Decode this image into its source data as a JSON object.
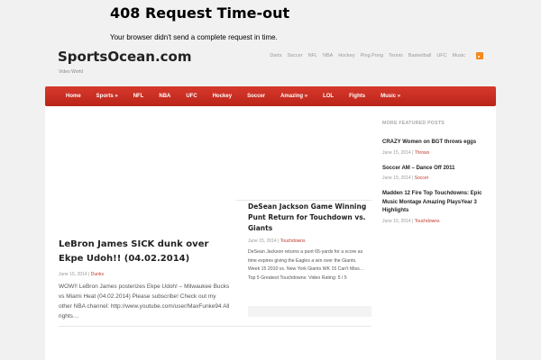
{
  "error": {
    "title": "408 Request Time-out",
    "message": "Your browser didn't send a complete request in time."
  },
  "site": {
    "name": "SportsOcean.com",
    "tagline": "Video World"
  },
  "top_nav": [
    "Darts",
    "Soccer",
    "NFL",
    "NBA",
    "Hockey",
    "Ping Pong",
    "Tennis",
    "Basketball",
    "UFC",
    "Music"
  ],
  "menu": [
    "Home",
    "Sports »",
    "NFL",
    "NBA",
    "UFC",
    "Hockey",
    "Soccer",
    "Amazing »",
    "LOL",
    "Fights",
    "Music »"
  ],
  "posts": [
    {
      "title": "LeBron James SICK dunk over Ekpe Udoh!! (04.02.2014)",
      "date": "June 15, 2014",
      "sep": " | ",
      "category": "Dunks",
      "excerpt": "WOW!! LeBron James posterizes Ekpe Udoh! – Milwaukee Bucks vs Miami Heat (04.02.2014) Please subscribe! Check out my other NBA channel: http://www.youtube.com/user/MaxFunke94 All rights…"
    },
    {
      "title": "DeSean Jackson Game Winning Punt Return for Touchdown vs. Giants",
      "date": "June 15, 2014",
      "sep": " | ",
      "category": "Touchdowns",
      "excerpt": "DeSean Jackson returns a punt 65-yards for a score as time expires giving the Eagles a win over the Giants. Week 15 2010 vs. New York Giants WK 15 Can't Miss… Top 5 Greatest Touchdowns: Video Rating: 5 / 5"
    }
  ],
  "sidebar": {
    "heading": "MORE FEATURED POSTS",
    "items": [
      {
        "title": "CRAZY Women on BGT throws eggs",
        "date": "June 15, 2014",
        "sep": " | ",
        "category": "Throws"
      },
      {
        "title": "Soccer AM – Dance Off 2011",
        "date": "June 15, 2014",
        "sep": " | ",
        "category": "Soccer"
      },
      {
        "title": "Madden 12 Fire Top Touchdowns: Epic Music Montage Amazing PlaysYear 3 Highlights",
        "date": "June 15, 2014",
        "sep": " | ",
        "category": "Touchdowns"
      }
    ]
  },
  "colors": {
    "menu_red": "#c9301f",
    "category_link": "#c0392b",
    "rss": "#f48a1e"
  }
}
